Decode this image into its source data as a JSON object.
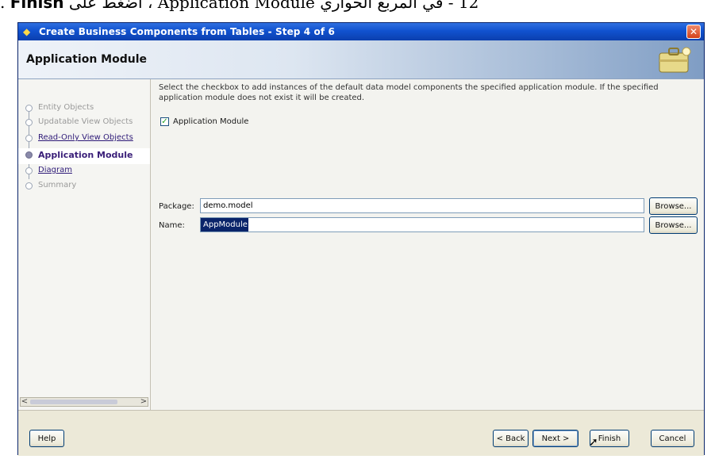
{
  "caption": {
    "prefix": "12 - في المربع الحواري ",
    "module": "Application Module",
    "middle": " ، اضغط على ",
    "finish": "Finish",
    "suffix": " ."
  },
  "window": {
    "title": "Create Business Components from Tables - Step 4 of 6",
    "close_glyph": "✕"
  },
  "banner": {
    "heading": "Application Module"
  },
  "nav": {
    "items": [
      {
        "label": "Entity Objects",
        "state": "disabled"
      },
      {
        "label": "Updatable View Objects",
        "state": "disabled"
      },
      {
        "label": "Read-Only View Objects",
        "state": "link"
      },
      {
        "label": "Application Module",
        "state": "current"
      },
      {
        "label": "Diagram",
        "state": "link"
      },
      {
        "label": "Summary",
        "state": "disabled"
      }
    ],
    "scroll_left": "<",
    "scroll_right": ">"
  },
  "content": {
    "instructions": "Select the checkbox to add instances of the default data model components the specified application module. If the specified application module does not exist it will be created.",
    "checkbox_label": "Application Module",
    "checkbox_checked": true,
    "package_label": "Package:",
    "package_value": "demo.model",
    "name_label": "Name:",
    "name_value": "AppModule",
    "browse_label": "Browse..."
  },
  "footer": {
    "help": "Help",
    "back": "< Back",
    "next": "Next >",
    "finish": "Finish",
    "cancel": "Cancel"
  },
  "colors": {
    "titlebar": "#1152cf",
    "nav_current": "#3b2079",
    "link": "#2e1a78"
  }
}
